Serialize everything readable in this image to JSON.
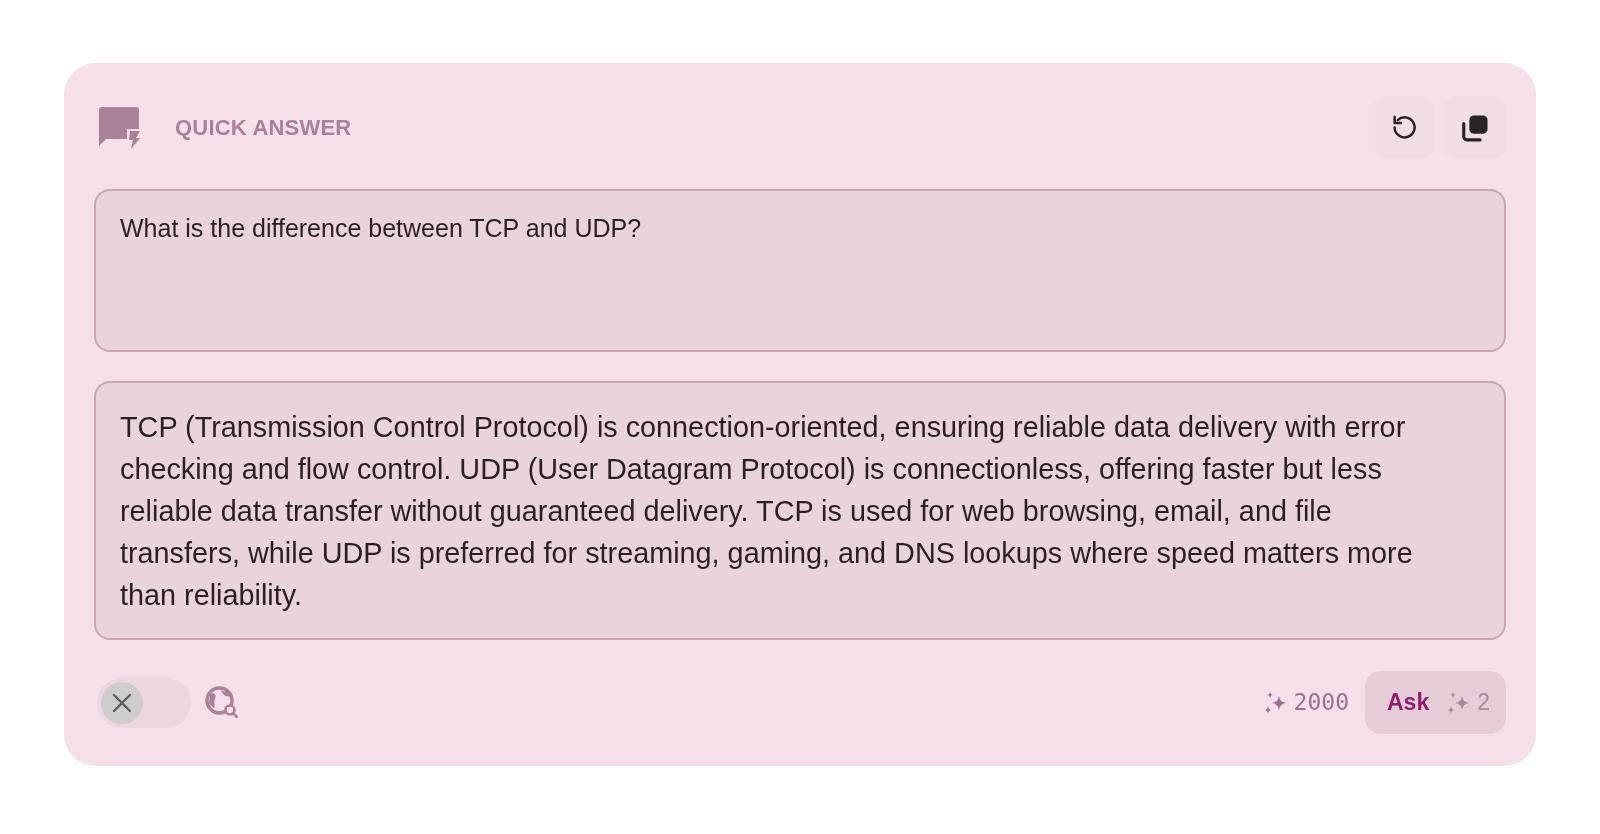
{
  "header": {
    "title": "QUICK ANSWER"
  },
  "question": {
    "value": "What is the difference between TCP and UDP?"
  },
  "answer": {
    "text": "TCP (Transmission Control Protocol) is connection-oriented, ensuring reliable data delivery with error checking and flow control. UDP (User Datagram Protocol) is connectionless, offering faster but less reliable data transfer without guaranteed delivery. TCP is used for web browsing, email, and file transfers, while UDP is preferred for streaming, gaming, and DNS lookups where speed matters more than reliability."
  },
  "footer": {
    "web_search": {
      "on": false
    },
    "credits": "2000",
    "ask_button": {
      "label": "Ask",
      "cost": "2"
    }
  }
}
